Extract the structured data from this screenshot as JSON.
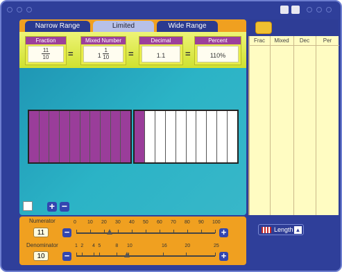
{
  "tabs": [
    {
      "label": "Narrow Range"
    },
    {
      "label": "Limited"
    },
    {
      "label": "Wide Range"
    }
  ],
  "representations": {
    "fraction": {
      "header": "Fraction",
      "numerator": "11",
      "denominator": "10"
    },
    "mixed": {
      "header": "Mixed Number",
      "whole": "1",
      "numerator": "1",
      "denominator": "10"
    },
    "decimal": {
      "header": "Decimal",
      "value": "1.1"
    },
    "percent": {
      "header": "Percent",
      "value": "110%"
    },
    "equals": "="
  },
  "bars": {
    "bar1": {
      "segments": 10,
      "filled": 10
    },
    "bar2": {
      "segments": 10,
      "filled": 1
    }
  },
  "table": {
    "columns": [
      "Frac",
      "Mixed",
      "Dec",
      "Per"
    ]
  },
  "numerator": {
    "label": "Numerator",
    "value": "11",
    "ticks": [
      "0",
      "10",
      "20",
      "30",
      "40",
      "50",
      "60",
      "70",
      "80",
      "90",
      "100"
    ]
  },
  "denominator": {
    "label": "Denominator",
    "value": "10",
    "ticks": [
      "1",
      "2",
      "4",
      "5",
      "8",
      "10",
      "16",
      "20",
      "25"
    ]
  },
  "length_button": {
    "label": "Length"
  },
  "buttons": {
    "plus": "+",
    "minus": "−",
    "up": "▲"
  }
}
